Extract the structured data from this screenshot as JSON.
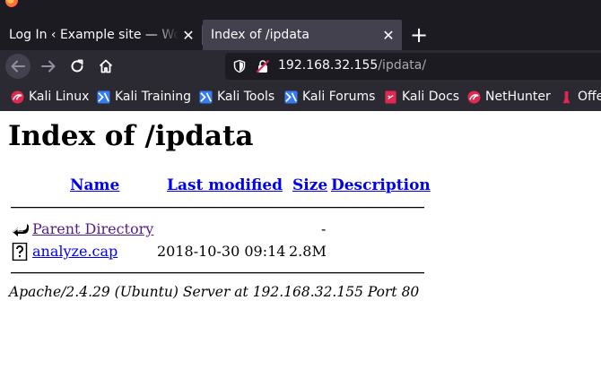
{
  "browser": {
    "tabs": [
      {
        "label": "Log In ‹ Example site — WordPress",
        "close": "✕"
      },
      {
        "label": "Index of /ipdata",
        "close": "✕"
      }
    ],
    "new_tab": "+",
    "url": {
      "host": "192.168.32.155",
      "path": "/ipdata/"
    },
    "bookmarks": [
      {
        "label": "Kali Linux",
        "icon": "kali-dragon-icon"
      },
      {
        "label": "Kali Training",
        "icon": "kali-training-icon"
      },
      {
        "label": "Kali Tools",
        "icon": "kali-tools-icon"
      },
      {
        "label": "Kali Forums",
        "icon": "kali-forums-icon"
      },
      {
        "label": "Kali Docs",
        "icon": "kali-docs-icon"
      },
      {
        "label": "NetHunter",
        "icon": "nethunter-icon"
      },
      {
        "label": "Offensive Security",
        "icon": "offsec-icon"
      }
    ],
    "colors": {
      "chrome_dark": "#1c1b22",
      "toolbar": "#2b2a33",
      "active_tab": "#42414d"
    }
  },
  "page": {
    "title": "Index of /ipdata",
    "columns": {
      "name": "Name",
      "last_modified": "Last modified",
      "size": "Size",
      "description": "Description"
    },
    "rows": [
      {
        "name": "Parent Directory",
        "modified": "",
        "size": "-",
        "icon": "back-arrow-icon"
      },
      {
        "name": "analyze.cap",
        "modified": "2018-10-30 09:14",
        "size": "2.8M",
        "icon": "unknown-file-icon"
      }
    ],
    "footer": "Apache/2.4.29 (Ubuntu) Server at 192.168.32.155 Port 80",
    "colors": {
      "link": "#0000ee",
      "visited": "#551a8b"
    }
  }
}
